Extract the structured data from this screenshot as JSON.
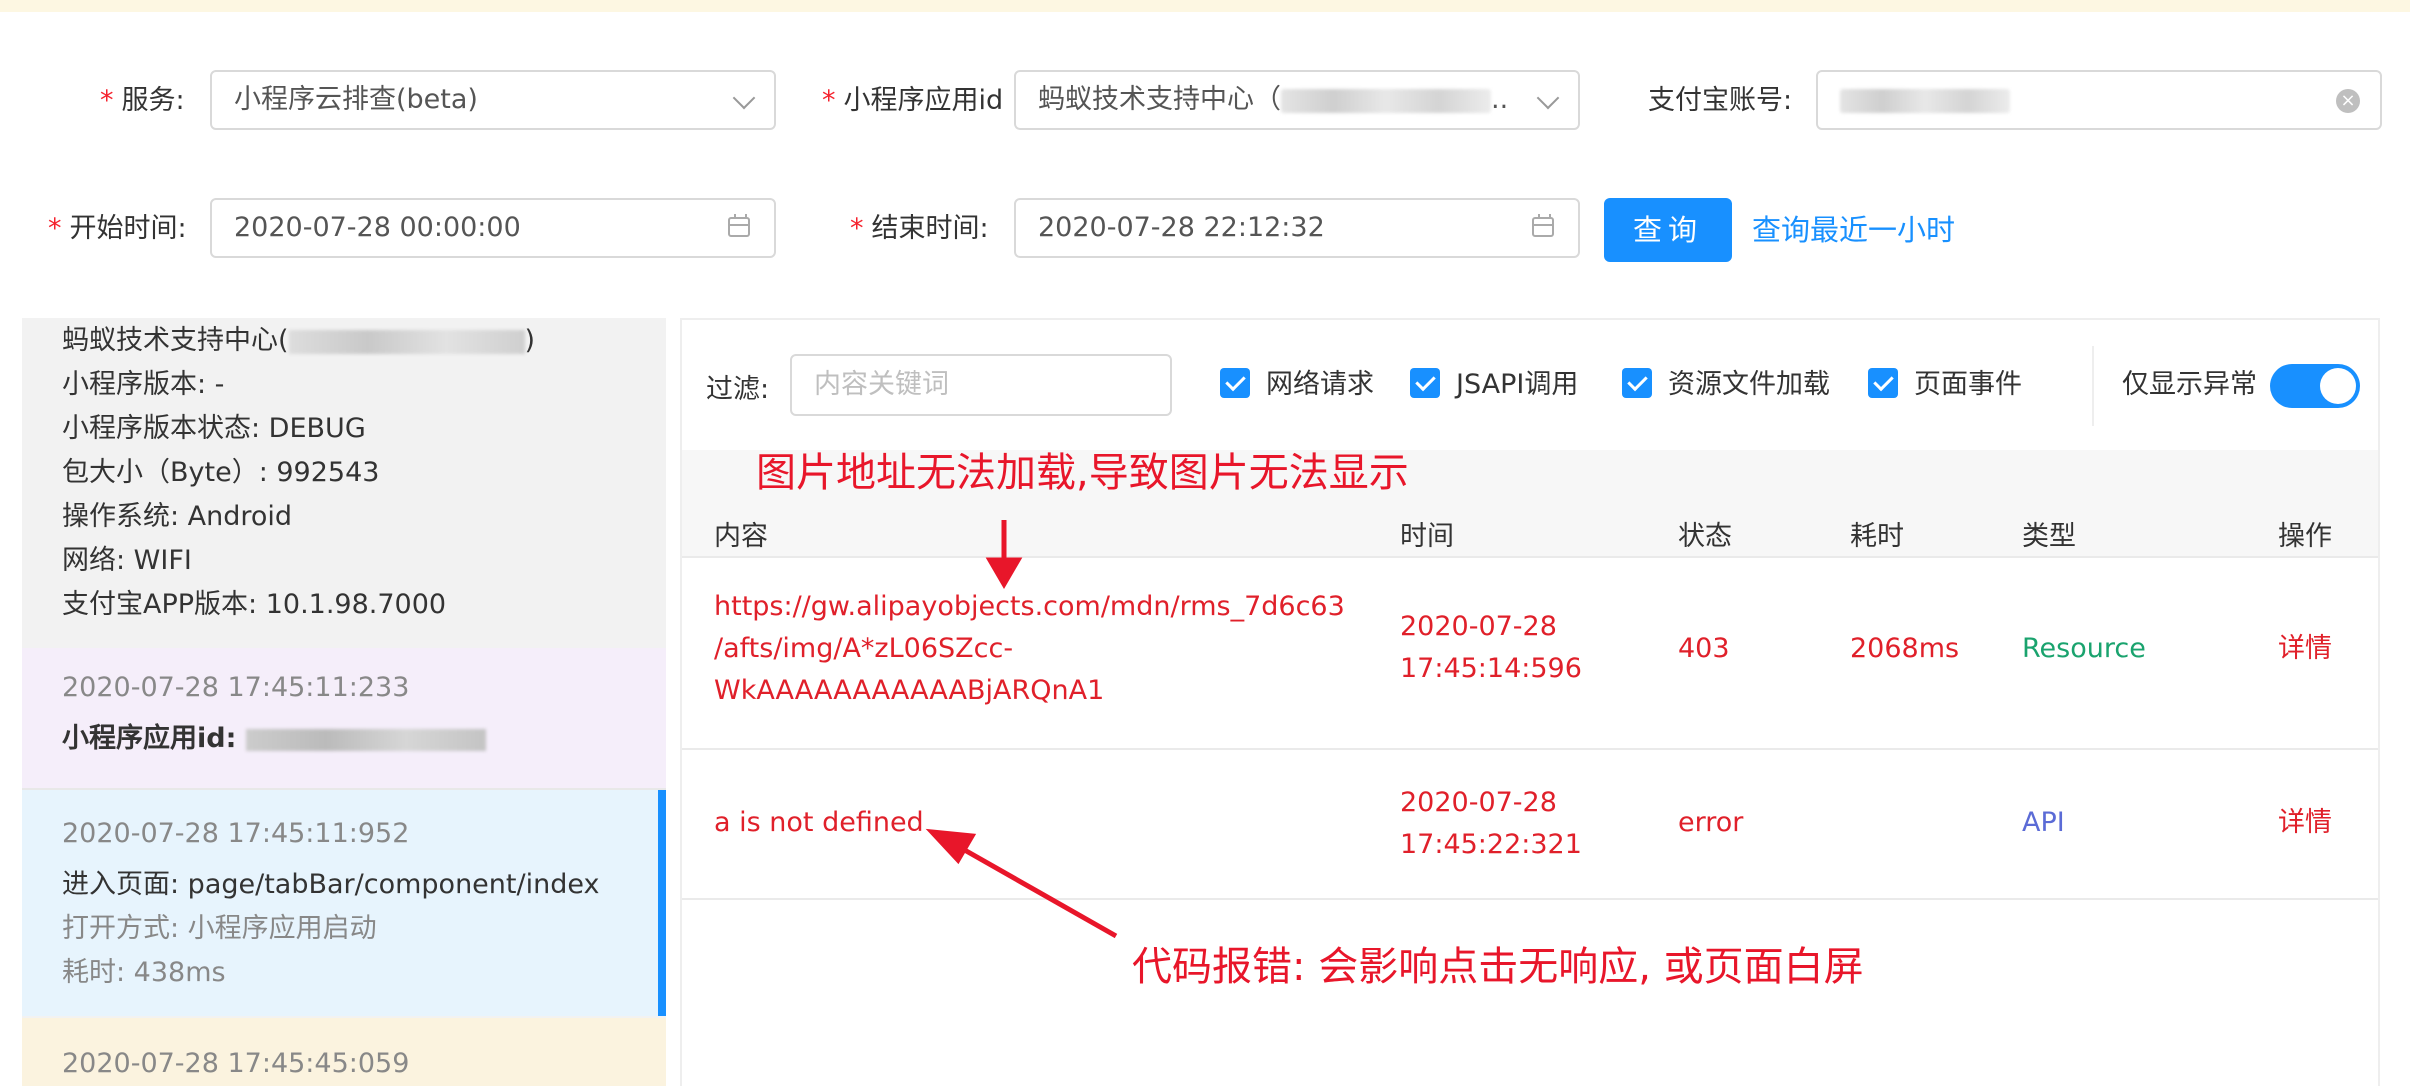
{
  "form": {
    "service": {
      "label": "服务:",
      "value": "小程序云排查(beta)"
    },
    "app_id": {
      "label": "小程序应用id",
      "value": "蚂蚁技术支持中心（"
    },
    "alipay_account": {
      "label": "支付宝账号:",
      "clear": "×"
    },
    "start_time": {
      "label": "开始时间:",
      "value": "2020-07-28 00:00:00"
    },
    "end_time": {
      "label": "结束时间:",
      "value": "2020-07-28 22:12:32"
    },
    "query_button": "查询",
    "query_last_hour": "查询最近一小时",
    "required_mark": "*",
    "ellipsis": ".."
  },
  "left_panel": {
    "device_info": {
      "name": "蚂蚁技术支持中心(",
      "name_close": ")",
      "version": "小程序版本: -",
      "version_status": "小程序版本状态: DEBUG",
      "package_size": "包大小（Byte）: 992543",
      "os": "操作系统: Android",
      "network": "网络: WIFI",
      "alipay_version": "支付宝APP版本: 10.1.98.7000"
    },
    "events": [
      {
        "time": "2020-07-28 17:45:11:233",
        "text": "小程序应用id:"
      },
      {
        "time": "2020-07-28 17:45:11:952",
        "text": "进入页面: page/tabBar/component/index",
        "open_mode": "打开方式: 小程序应用启动",
        "duration": "耗时: 438ms"
      },
      {
        "time": "2020-07-28 17:45:45:059"
      }
    ]
  },
  "filter": {
    "label": "过滤:",
    "placeholder": "内容关键词",
    "checkboxes": [
      "网络请求",
      "JSAPI调用",
      "资源文件加载",
      "页面事件"
    ],
    "only_abnormal_label": "仅显示异常",
    "only_abnormal": true
  },
  "table": {
    "headers": [
      "内容",
      "时间",
      "状态",
      "耗时",
      "类型",
      "操作"
    ],
    "rows": [
      {
        "content": [
          "https://gw.alipayobjects.com/mdn/rms_7d6c63",
          "/afts/img/A*zL06SZcc-",
          "WkAAAAAAAAAAABjARQnA1"
        ],
        "time": [
          "2020-07-28",
          "17:45:14:596"
        ],
        "status": "403",
        "duration": "2068ms",
        "type": "Resource",
        "action": "详情"
      },
      {
        "content": [
          "a is not defined"
        ],
        "time": [
          "2020-07-28",
          "17:45:22:321"
        ],
        "status": "error",
        "duration": "",
        "type": "API",
        "action": "详情"
      }
    ]
  },
  "annotations": {
    "image_error": "图片地址无法加载,导致图片无法显示",
    "code_error": "代码报错: 会影响点击无响应, 或页面白屏"
  },
  "colors": {
    "primary": "#1890ff",
    "error": "#e0202a",
    "annotation": "#e8162a",
    "resource": "#1aa36e",
    "api": "#5b6bd6"
  }
}
